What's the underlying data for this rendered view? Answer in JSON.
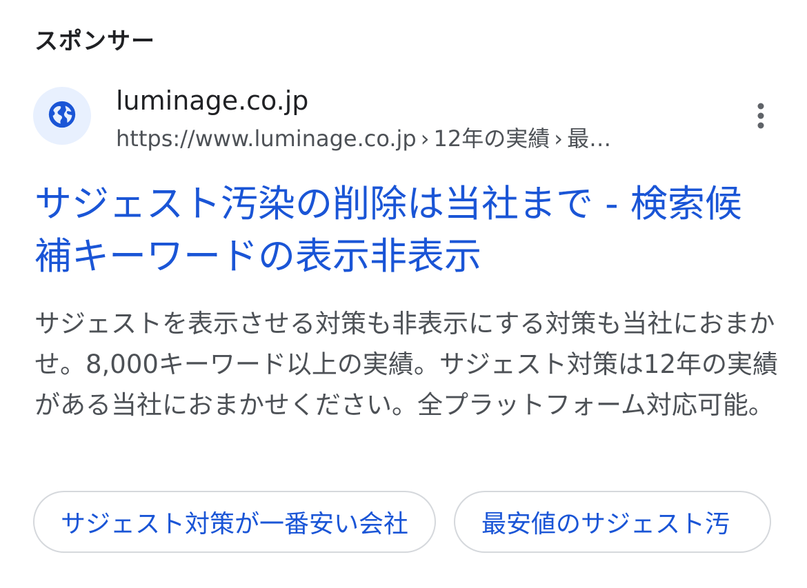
{
  "section_label": "スポンサー",
  "advertiser": {
    "site_name": "luminage.co.jp",
    "url_base": "https://www.luminage.co.jp",
    "breadcrumb_1": "12年の実績",
    "breadcrumb_2": "最…",
    "favicon_icon": "globe-icon",
    "more_icon": "more-vert-icon"
  },
  "ad": {
    "title": "サジェスト汚染の削除は当社まで - 検索候補キーワードの表示非表示",
    "description": "サジェストを表示させる対策も非表示にする対策も当社におまかせ。8,000キーワード以上の実績。サジェスト対策は12年の実績がある当社におまかせください。全プラットフォーム対応可能。"
  },
  "sitelinks": [
    {
      "label": "サジェスト対策が一番安い会社"
    },
    {
      "label": "最安値のサジェスト汚"
    }
  ],
  "colors": {
    "link_blue": "#1a55d6",
    "text_gray": "#4d5156",
    "favicon_bg": "#e8f0fe"
  }
}
